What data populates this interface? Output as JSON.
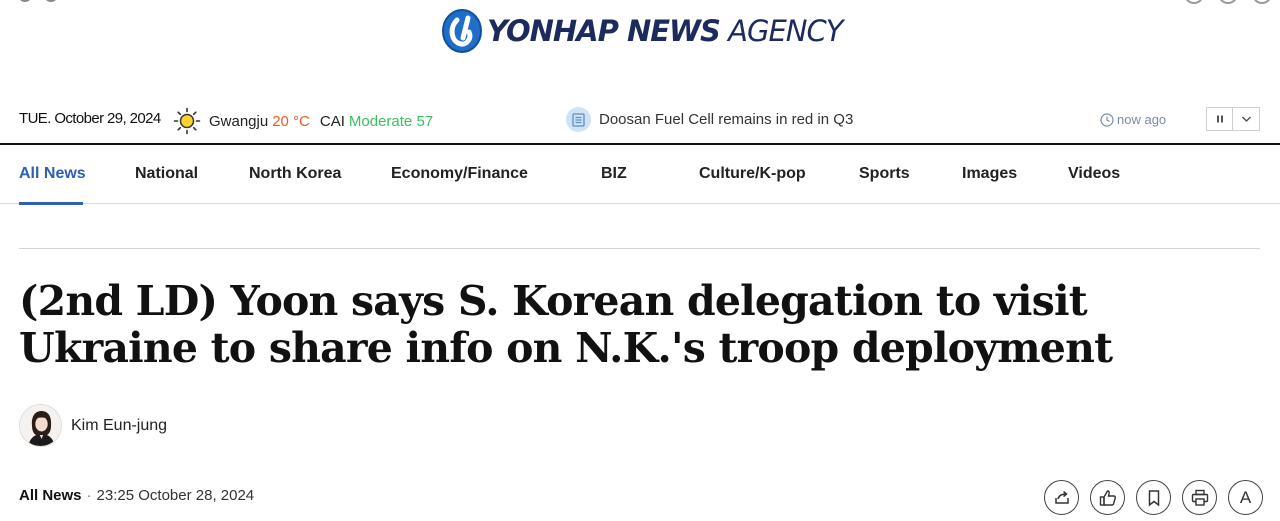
{
  "header": {
    "logo_bold": "YONHAP NEWS",
    "logo_light": "AGENCY"
  },
  "info_bar": {
    "date": "TUE. October 29, 2024",
    "weather_icon": "sun-icon",
    "city": "Gwangju",
    "temperature": "20 °C",
    "cai_label": "CAI",
    "cai_value": "Moderate 57",
    "ticker_icon": "document-icon",
    "ticker_headline": "Doosan Fuel Cell remains in red in Q3",
    "time_ago": "now ago",
    "pause_icon": "pause-icon",
    "expand_icon": "chevron-down-icon"
  },
  "nav": {
    "items": [
      {
        "label": "All News",
        "active": true
      },
      {
        "label": "National"
      },
      {
        "label": "North Korea"
      },
      {
        "label": "Economy/Finance"
      },
      {
        "label": "BIZ"
      },
      {
        "label": "Culture/K-pop"
      },
      {
        "label": "Sports"
      },
      {
        "label": "Images"
      },
      {
        "label": "Videos"
      }
    ]
  },
  "article": {
    "headline": "(2nd LD) Yoon says S. Korean delegation to visit Ukraine to share info on N.K.'s troop deployment",
    "author": "Kim Eun-jung",
    "section": "All News",
    "timestamp": "23:25 October 28, 2024"
  },
  "actions": {
    "font_button_label": "A",
    "icons": [
      "share-icon",
      "like-icon",
      "bookmark-icon",
      "print-icon",
      "font-size-icon"
    ]
  },
  "colors": {
    "brand_navy": "#1d2a5c",
    "nav_active": "#2d5fb5",
    "temperature": "#f05a28",
    "cai_good": "#3cbf5e"
  }
}
